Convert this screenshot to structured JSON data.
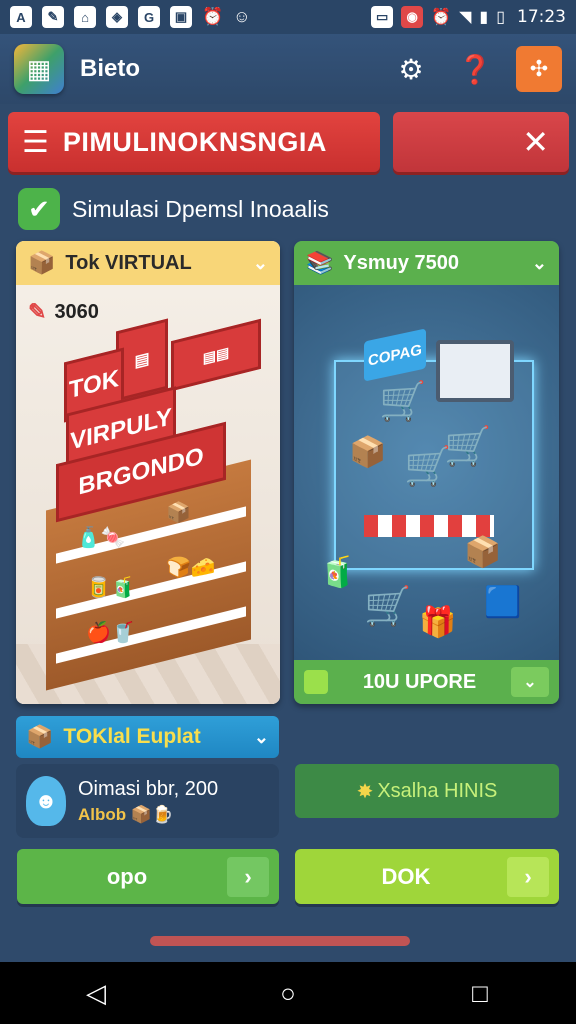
{
  "status_bar": {
    "time": "17:23",
    "icons_left": [
      "a-icon",
      "edit-icon",
      "home-icon",
      "shield-icon",
      "g-icon",
      "image-icon",
      "alarm-icon",
      "face-icon"
    ],
    "icons_right": [
      "chat-icon",
      "app-icon",
      "alarm-icon",
      "wifi-icon",
      "signal-icon",
      "battery-icon"
    ]
  },
  "header": {
    "title": "Bieto",
    "actions": [
      "gear-icon",
      "help-icon",
      "menu-icon"
    ]
  },
  "banner": {
    "title": "PIMULINOKNSNGIA",
    "close_symbol": "✕"
  },
  "subtitle": "Simulasi Dpemsl Inoaalis",
  "left_card": {
    "title": "Tok VIRTUAL",
    "edit_value": "3060",
    "sign_text_1": "TOK",
    "sign_text_2": "VIRPULY",
    "sign_text_3": "BRGONDO"
  },
  "right_card": {
    "title": "Ysmuy 7500",
    "coupon_sign": "COPAG",
    "footer_label": "10U UPORE"
  },
  "total": {
    "title": "TOKlal Euplat"
  },
  "info": {
    "line1": "Oimasi bbr, 200",
    "line2": "Albob"
  },
  "green_info": {
    "label": "Xsalha HINIS"
  },
  "buttons": {
    "left_label": "opo",
    "right_label": "DOK"
  },
  "colors": {
    "background": "#2f4a6b",
    "banner_red": "#d83b3b",
    "green": "#5cb548",
    "lime": "#9fd63a",
    "blue": "#2f9fd8",
    "orange": "#f07a32"
  }
}
